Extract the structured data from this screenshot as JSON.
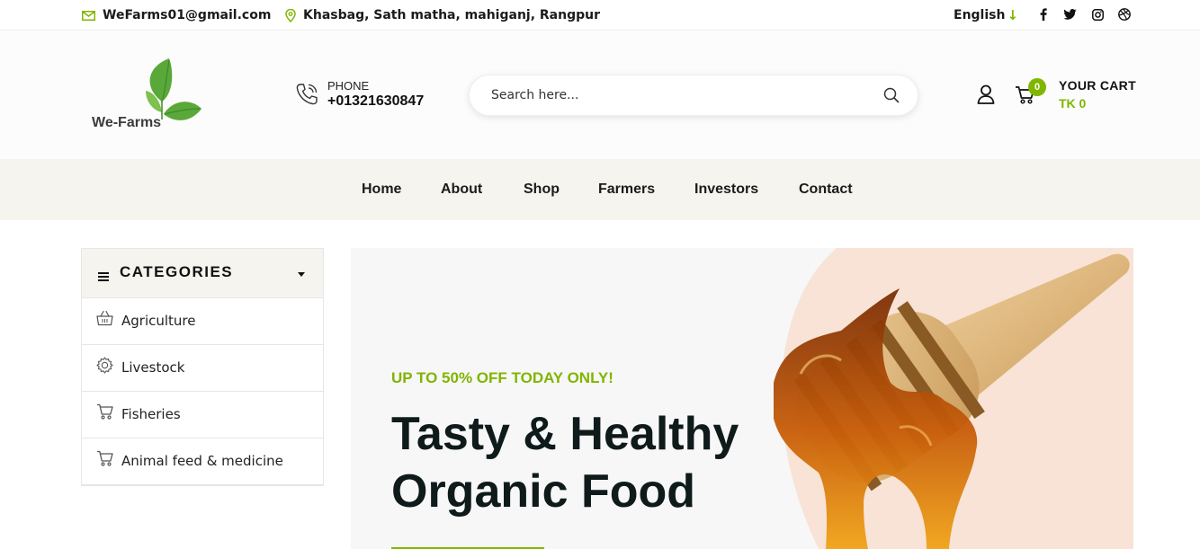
{
  "topbar": {
    "email": "WeFarms01@gmail.com",
    "address": "Khasbag, Sath matha, mahiganj, Rangpur",
    "language": "English",
    "social_icons": [
      "facebook-icon",
      "twitter-icon",
      "instagram-icon",
      "dribbble-icon"
    ]
  },
  "header": {
    "logo_text": "We-Farms",
    "phone_label": "PHONE",
    "phone_number": "+01321630847",
    "search_placeholder": "Search here...",
    "cart_count": "0",
    "cart_title": "YOUR CART",
    "cart_total": "TK 0"
  },
  "nav": {
    "items": [
      "Home",
      "About",
      "Shop",
      "Farmers",
      "Investors",
      "Contact"
    ]
  },
  "categories": {
    "title": "CATEGORIES",
    "items": [
      {
        "label": "Agriculture",
        "icon": "basket-icon"
      },
      {
        "label": "Livestock",
        "icon": "gear-icon"
      },
      {
        "label": "Fisheries",
        "icon": "cart-icon"
      },
      {
        "label": "Animal feed & medicine",
        "icon": "cart-icon"
      }
    ]
  },
  "hero": {
    "offer": "UP TO 50% OFF TODAY ONLY!",
    "title_line1": "Tasty & Healthy",
    "title_line2": "Organic Food"
  },
  "colors": {
    "accent": "#80b500",
    "nav_bg": "#f6f4ee",
    "hero_bg": "#f7f7f7",
    "hero_shape": "#f8e3d6",
    "honey": "#c56a10"
  }
}
